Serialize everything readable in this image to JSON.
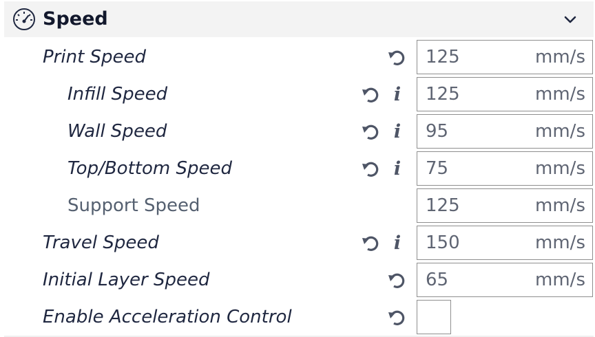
{
  "section": {
    "title": "Speed",
    "icon": "speedometer-icon",
    "toggle_icon": "chevron-down-icon"
  },
  "settings": [
    {
      "label": "Print Speed",
      "value": "125",
      "unit": "mm/s",
      "has_reset": true,
      "has_info": false
    },
    {
      "label": "Infill Speed",
      "value": "125",
      "unit": "mm/s",
      "has_reset": true,
      "has_info": true
    },
    {
      "label": "Wall Speed",
      "value": "95",
      "unit": "mm/s",
      "has_reset": true,
      "has_info": true
    },
    {
      "label": "Top/Bottom Speed",
      "value": "75",
      "unit": "mm/s",
      "has_reset": true,
      "has_info": true
    },
    {
      "label": "Support Speed",
      "value": "125",
      "unit": "mm/s",
      "has_reset": false,
      "has_info": false
    },
    {
      "label": "Travel Speed",
      "value": "150",
      "unit": "mm/s",
      "has_reset": true,
      "has_info": true
    },
    {
      "label": "Initial Layer Speed",
      "value": "65",
      "unit": "mm/s",
      "has_reset": true,
      "has_info": false
    },
    {
      "label": "Enable Acceleration Control",
      "checked": false,
      "has_reset": true,
      "has_info": false
    }
  ],
  "info_glyph": "i",
  "colors": {
    "text": "#1f2740",
    "muted_text": "#556070",
    "field_border": "#8e8e8e",
    "header_bg": "#f3f3f3"
  }
}
